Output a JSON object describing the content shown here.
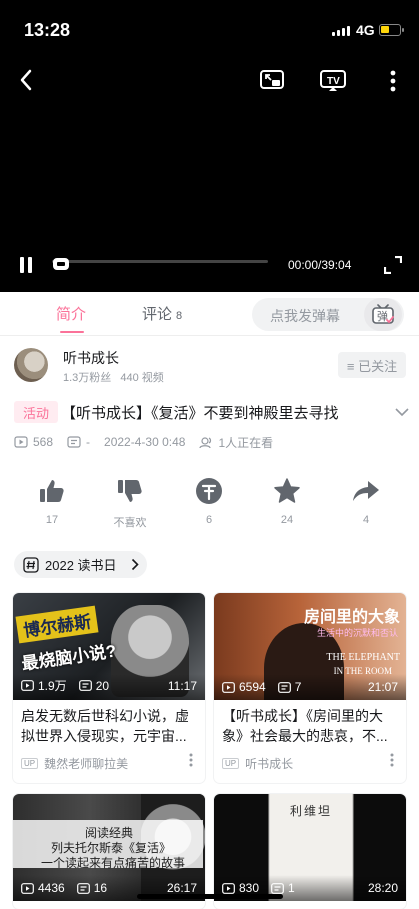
{
  "status_bar": {
    "time": "13:28",
    "network": "4G"
  },
  "player": {
    "time_display": "00:00/39:04",
    "progress": 0
  },
  "tabs": {
    "intro": "简介",
    "comments": "评论",
    "comment_count": "8"
  },
  "danmu": {
    "placeholder": "点我发弹幕",
    "button_glyph": "弹"
  },
  "uploader": {
    "name": "听书成长",
    "fans": "1.3万粉丝",
    "videos": "440 视频",
    "follow_label": "≡ 已关注"
  },
  "video": {
    "badge": "活动",
    "title": "【听书成长】《复活》不要到神殿里去寻找",
    "views": "568",
    "danmaku": "-",
    "date": "2022-4-30 0:48",
    "watching": "1人正在看"
  },
  "actions": [
    {
      "icon": "thumb-up-icon",
      "label": "17"
    },
    {
      "icon": "thumb-down-icon",
      "label": "不喜欢"
    },
    {
      "icon": "coin-icon",
      "label": "6"
    },
    {
      "icon": "star-icon",
      "label": "24"
    },
    {
      "icon": "share-icon",
      "label": "4"
    }
  ],
  "topic": {
    "label": "2022 读书日"
  },
  "cards": [
    {
      "thumb_text_1": "博尔赫斯",
      "thumb_text_2": "最烧脑小说?",
      "views": "1.9万",
      "danmaku": "20",
      "duration": "11:17",
      "title": "启发无数后世科幻小说，虚拟世界入侵现实，元宇宙...",
      "up": "魏然老师聊拉美"
    },
    {
      "thumb_text_1": "房间里的大象",
      "thumb_text_2": "生活中的沉默和否认",
      "thumb_text_3": "THE ELEPHANT",
      "thumb_text_4": "IN THE ROOM",
      "views": "6594",
      "danmaku": "7",
      "duration": "21:07",
      "title": "【听书成长】《房间里的大象》社会最大的悲哀，不...",
      "up": "听书成长"
    },
    {
      "thumb_text_1": "阅读经典",
      "thumb_text_2": "列夫托尔斯泰《复活》",
      "thumb_text_3": "一个读起来有点痛苦的故事",
      "views": "4436",
      "danmaku": "16",
      "duration": "26:17"
    },
    {
      "thumb_text_1": "利维坦",
      "views": "830",
      "danmaku": "1",
      "duration": "28:20"
    }
  ],
  "colors": {
    "accent": "#fb7299",
    "muted": "#9499a0"
  }
}
